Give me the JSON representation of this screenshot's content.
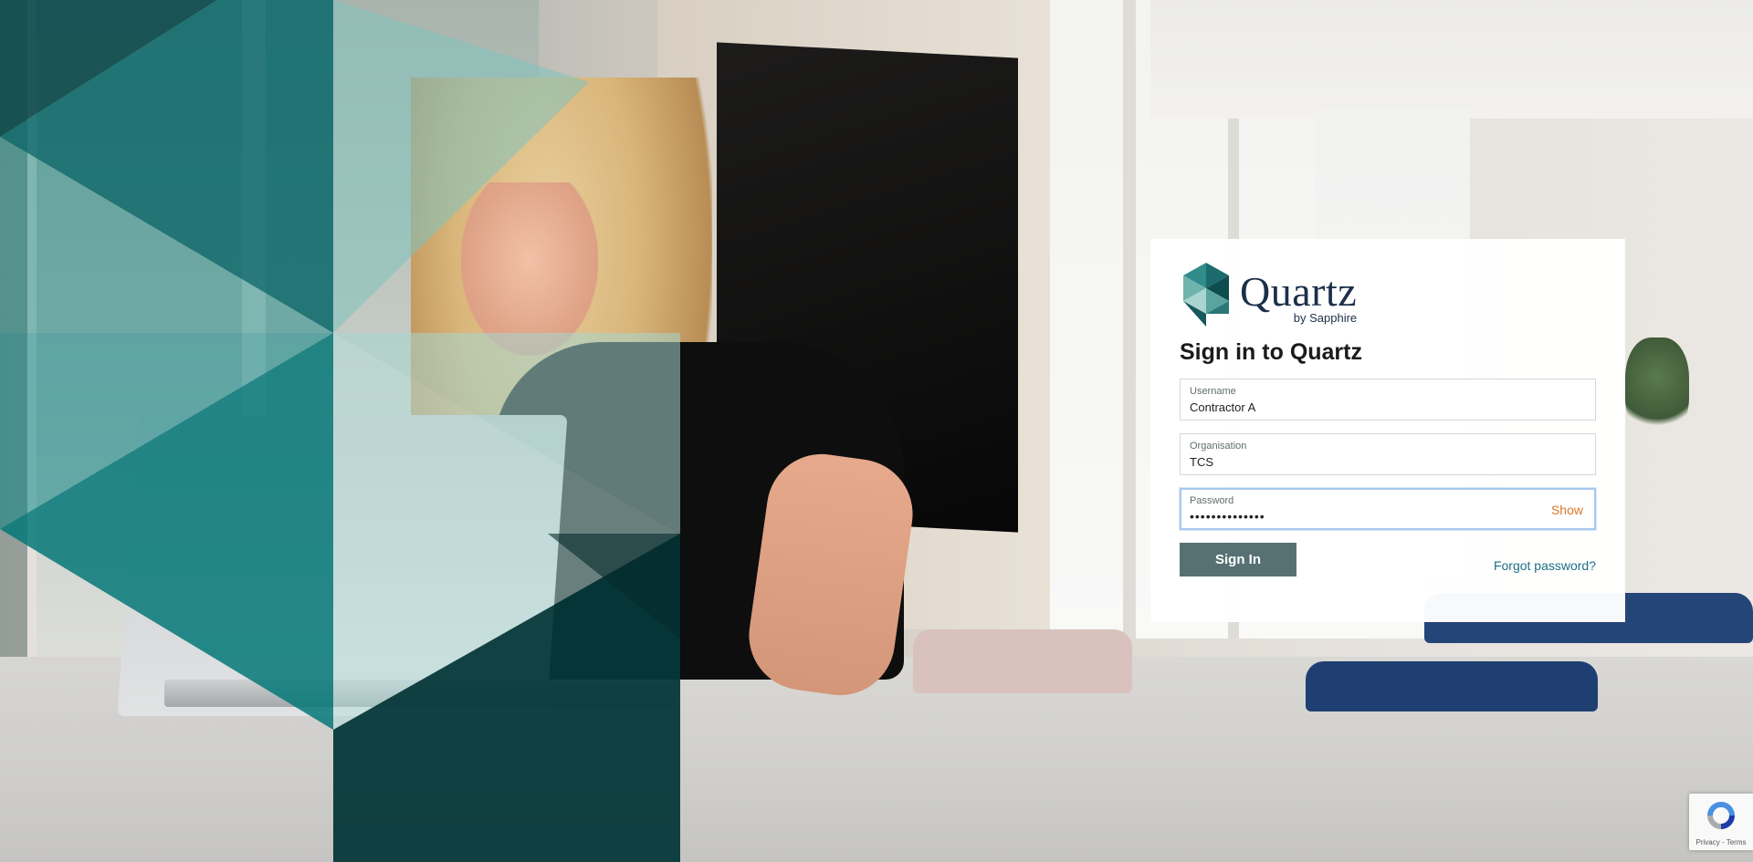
{
  "brand": {
    "name": "Quartz",
    "sub": "by Sapphire",
    "colors": {
      "navy": "#1d2f49",
      "teal_dark": "#0d4b4d",
      "teal": "#1b8a8a",
      "teal_light": "#a5d6d0"
    }
  },
  "login": {
    "title": "Sign in to Quartz",
    "username": {
      "label": "Username",
      "value": "Contractor A"
    },
    "organisation": {
      "label": "Organisation",
      "value": "TCS"
    },
    "password": {
      "label": "Password",
      "value": "••••••••••••••",
      "toggle_label": "Show"
    },
    "signin_label": "Sign In",
    "forgot_label": "Forgot password?"
  },
  "recaptcha": {
    "links_label": "Privacy - Terms",
    "icon": "recaptcha-icon"
  },
  "colors": {
    "button": "#577173",
    "link": "#1c6e88",
    "toggle": "#d9782b",
    "focus_border": "#a9c9ee"
  }
}
